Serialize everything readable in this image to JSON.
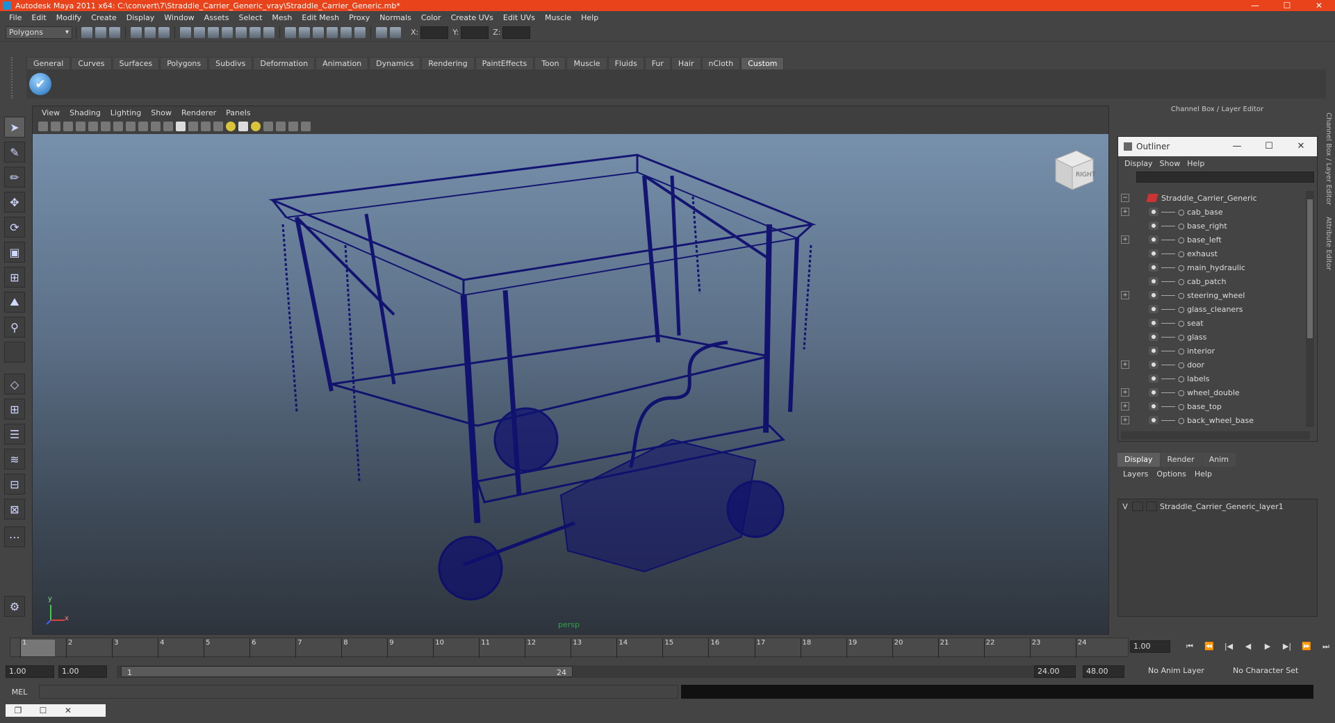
{
  "window": {
    "title": "Autodesk Maya 2011 x64: C:\\convert\\7\\Straddle_Carrier_Generic_vray\\Straddle_Carrier_Generic.mb*",
    "minimize": "—",
    "maximize": "☐",
    "close": "✕"
  },
  "menubar": [
    "File",
    "Edit",
    "Modify",
    "Create",
    "Display",
    "Window",
    "Assets",
    "Select",
    "Mesh",
    "Edit Mesh",
    "Proxy",
    "Normals",
    "Color",
    "Create UVs",
    "Edit UVs",
    "Muscle",
    "Help"
  ],
  "statusline": {
    "mode": "Polygons",
    "x_label": "X:",
    "y_label": "Y:",
    "z_label": "Z:"
  },
  "shelf": {
    "tabs": [
      "General",
      "Curves",
      "Surfaces",
      "Polygons",
      "Subdivs",
      "Deformation",
      "Animation",
      "Dynamics",
      "Rendering",
      "PaintEffects",
      "Toon",
      "Muscle",
      "Fluids",
      "Fur",
      "Hair",
      "nCloth",
      "Custom"
    ],
    "active_tab": "Custom"
  },
  "viewport": {
    "menu": [
      "View",
      "Shading",
      "Lighting",
      "Show",
      "Renderer",
      "Panels"
    ],
    "camera": "persp",
    "viewcube_label": "RIGHT",
    "axis_x": "x",
    "axis_y": "y"
  },
  "channelbox": {
    "title": "Channel Box / Layer Editor"
  },
  "outliner": {
    "title": "Outliner",
    "menu": [
      "Display",
      "Show",
      "Help"
    ],
    "root": "Straddle_Carrier_Generic",
    "items": [
      {
        "name": "cab_base",
        "expandable": true
      },
      {
        "name": "base_right",
        "expandable": false
      },
      {
        "name": "base_left",
        "expandable": true
      },
      {
        "name": "exhaust",
        "expandable": false
      },
      {
        "name": "main_hydraulic",
        "expandable": false
      },
      {
        "name": "cab_patch",
        "expandable": false
      },
      {
        "name": "steering_wheel",
        "expandable": true
      },
      {
        "name": "glass_cleaners",
        "expandable": false
      },
      {
        "name": "seat",
        "expandable": false
      },
      {
        "name": "glass",
        "expandable": false
      },
      {
        "name": "interior",
        "expandable": false
      },
      {
        "name": "door",
        "expandable": true
      },
      {
        "name": "labels",
        "expandable": false
      },
      {
        "name": "wheel_double",
        "expandable": true
      },
      {
        "name": "base_top",
        "expandable": true
      },
      {
        "name": "back_wheel_base",
        "expandable": true
      }
    ]
  },
  "layers": {
    "tabs": [
      "Display",
      "Render",
      "Anim"
    ],
    "active_tab": "Display",
    "menu": [
      "Layers",
      "Options",
      "Help"
    ],
    "rows": [
      {
        "visible": "V",
        "name": "Straddle_Carrier_Generic_layer1"
      }
    ]
  },
  "sidetabs": [
    "Channel Box / Layer Editor",
    "Attribute Editor"
  ],
  "timeslider": {
    "frames": [
      "1",
      "2",
      "3",
      "4",
      "5",
      "6",
      "7",
      "8",
      "9",
      "10",
      "11",
      "12",
      "13",
      "14",
      "15",
      "16",
      "17",
      "18",
      "19",
      "20",
      "21",
      "22",
      "23",
      "24"
    ],
    "current_frame": "1.00",
    "playback_buttons": [
      "⏮",
      "⏪",
      "|◀",
      "◀",
      "▶",
      "▶|",
      "⏩",
      "⏭"
    ]
  },
  "rangeslider": {
    "start": "1.00",
    "anim_start": "1.00",
    "range_start_label": "1",
    "range_end_label": "24",
    "range_end": "24.00",
    "anim_end": "48.00",
    "anim_layer": "No Anim Layer",
    "character_set": "No Character Set"
  },
  "cmdline": {
    "label": "MEL"
  }
}
